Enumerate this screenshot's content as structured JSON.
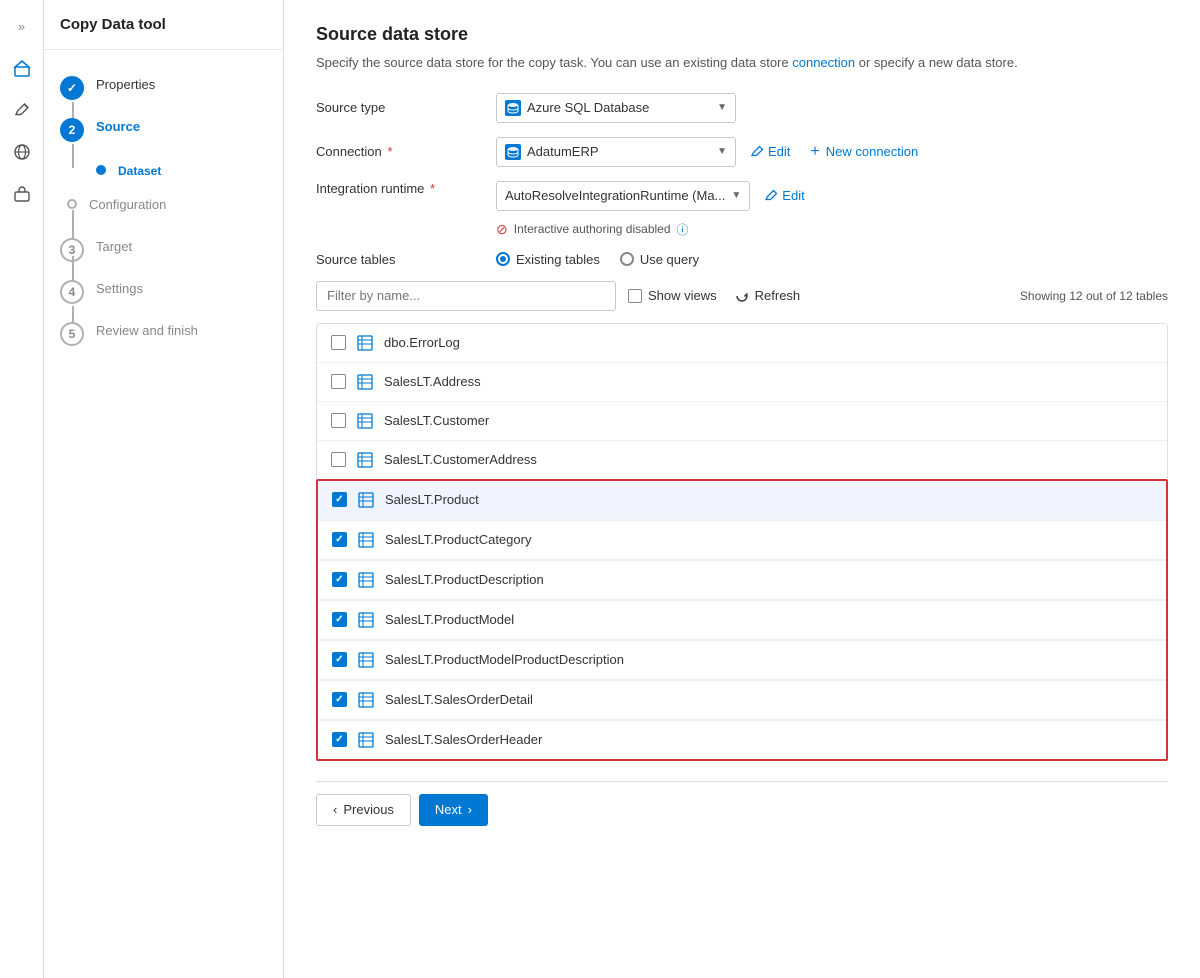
{
  "app": {
    "title": "Copy Data tool"
  },
  "sidebar_icons": [
    {
      "name": "expand-icon",
      "symbol": "»"
    },
    {
      "name": "home-icon",
      "symbol": "⊞"
    },
    {
      "name": "edit-icon",
      "symbol": "✎"
    },
    {
      "name": "globe-icon",
      "symbol": "⊙"
    },
    {
      "name": "briefcase-icon",
      "symbol": "⊡"
    }
  ],
  "steps": [
    {
      "number": "✓",
      "label": "Properties",
      "sub": "",
      "state": "completed"
    },
    {
      "number": "2",
      "label": "Source",
      "sub": "Dataset",
      "state": "active"
    },
    {
      "number": "3",
      "label": "Target",
      "sub": "",
      "state": "inactive"
    },
    {
      "number": "4",
      "label": "Settings",
      "sub": "",
      "state": "inactive"
    },
    {
      "number": "5",
      "label": "Review and finish",
      "sub": "",
      "state": "inactive"
    }
  ],
  "main": {
    "title": "Source data store",
    "description": "Specify the source data store for the copy task. You can use an existing data store connection or specify a new data store.",
    "desc_link_text": "connection",
    "form": {
      "source_type_label": "Source type",
      "source_type_value": "Azure SQL Database",
      "connection_label": "Connection",
      "connection_required": "*",
      "connection_value": "AdatumERP",
      "edit_label": "Edit",
      "new_connection_label": "New connection",
      "integration_runtime_label": "Integration runtime",
      "integration_runtime_required": "*",
      "integration_runtime_value": "AutoResolveIntegrationRuntime (Ma...",
      "integration_edit_label": "Edit",
      "interactive_authoring_label": "Interactive authoring disabled",
      "source_tables_label": "Source tables",
      "radio_existing": "Existing tables",
      "radio_query": "Use query"
    },
    "filter": {
      "placeholder": "Filter by name...",
      "show_views_label": "Show views",
      "refresh_label": "Refresh",
      "showing_count": "Showing 12 out of 12 tables"
    },
    "tables": [
      {
        "name": "dbo.ErrorLog",
        "checked": false,
        "in_selection": false
      },
      {
        "name": "SalesLT.Address",
        "checked": false,
        "in_selection": false
      },
      {
        "name": "SalesLT.Customer",
        "checked": false,
        "in_selection": false
      },
      {
        "name": "SalesLT.CustomerAddress",
        "checked": false,
        "in_selection": false
      },
      {
        "name": "SalesLT.Product",
        "checked": true,
        "in_selection": true
      },
      {
        "name": "SalesLT.ProductCategory",
        "checked": true,
        "in_selection": true
      },
      {
        "name": "SalesLT.ProductDescription",
        "checked": true,
        "in_selection": true
      },
      {
        "name": "SalesLT.ProductModel",
        "checked": true,
        "in_selection": true
      },
      {
        "name": "SalesLT.ProductModelProductDescription",
        "checked": true,
        "in_selection": true
      },
      {
        "name": "SalesLT.SalesOrderDetail",
        "checked": true,
        "in_selection": true
      },
      {
        "name": "SalesLT.SalesOrderHeader",
        "checked": true,
        "in_selection": true
      }
    ],
    "nav": {
      "previous_label": "Previous",
      "next_label": "Next"
    }
  }
}
